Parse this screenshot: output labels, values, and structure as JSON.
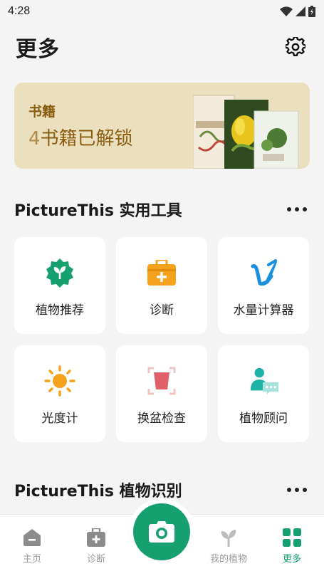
{
  "status_bar": {
    "time": "4:28"
  },
  "header": {
    "title": "更多"
  },
  "book_banner": {
    "title": "书籍",
    "count": "4",
    "subtitle": "书籍已解锁"
  },
  "tools_section": {
    "title": "PictureThis 实用工具",
    "items": [
      {
        "label": "植物推荐",
        "icon": "plant-badge-icon"
      },
      {
        "label": "诊断",
        "icon": "medical-kit-icon"
      },
      {
        "label": "水量计算器",
        "icon": "water-cup-icon"
      },
      {
        "label": "光度计",
        "icon": "sun-icon"
      },
      {
        "label": "换盆检查",
        "icon": "pot-scan-icon"
      },
      {
        "label": "植物顾问",
        "icon": "advisor-chat-icon"
      }
    ]
  },
  "identify_section": {
    "title": "PictureThis 植物识别"
  },
  "tab_bar": {
    "items": [
      {
        "label": "主页",
        "icon": "home-icon"
      },
      {
        "label": "诊断",
        "icon": "diagnose-icon"
      },
      {
        "label": "我的植物",
        "icon": "sprout-icon"
      },
      {
        "label": "更多",
        "icon": "grid-icon",
        "active": true
      }
    ],
    "camera": "camera-icon"
  },
  "colors": {
    "brand_green": "#16a06f",
    "banner_bg": "#ebe0bd",
    "banner_text": "#8a5c10",
    "orange": "#f5a21c",
    "blue": "#1a8fe0",
    "pot_red": "#e0606a",
    "teal": "#1fb2a6"
  }
}
